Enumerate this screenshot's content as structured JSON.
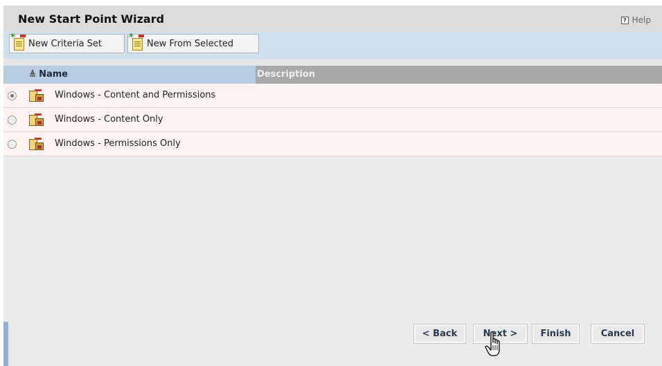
{
  "wizard": {
    "title": "New Start Point Wizard",
    "help_label": "Help"
  },
  "toolbar": {
    "new_criteria_set_label": "New Criteria Set",
    "new_from_selected_label": "New From Selected"
  },
  "grid": {
    "columns": [
      "Name",
      "Description"
    ],
    "rows": [
      {
        "name": "Windows - Content and Permissions",
        "description": "",
        "selected": true
      },
      {
        "name": "Windows - Content Only",
        "description": "",
        "selected": false
      },
      {
        "name": "Windows - Permissions Only",
        "description": "",
        "selected": false
      }
    ]
  },
  "buttons": {
    "back": "< Back",
    "next": "Next >",
    "finish": "Finish",
    "cancel": "Cancel"
  }
}
